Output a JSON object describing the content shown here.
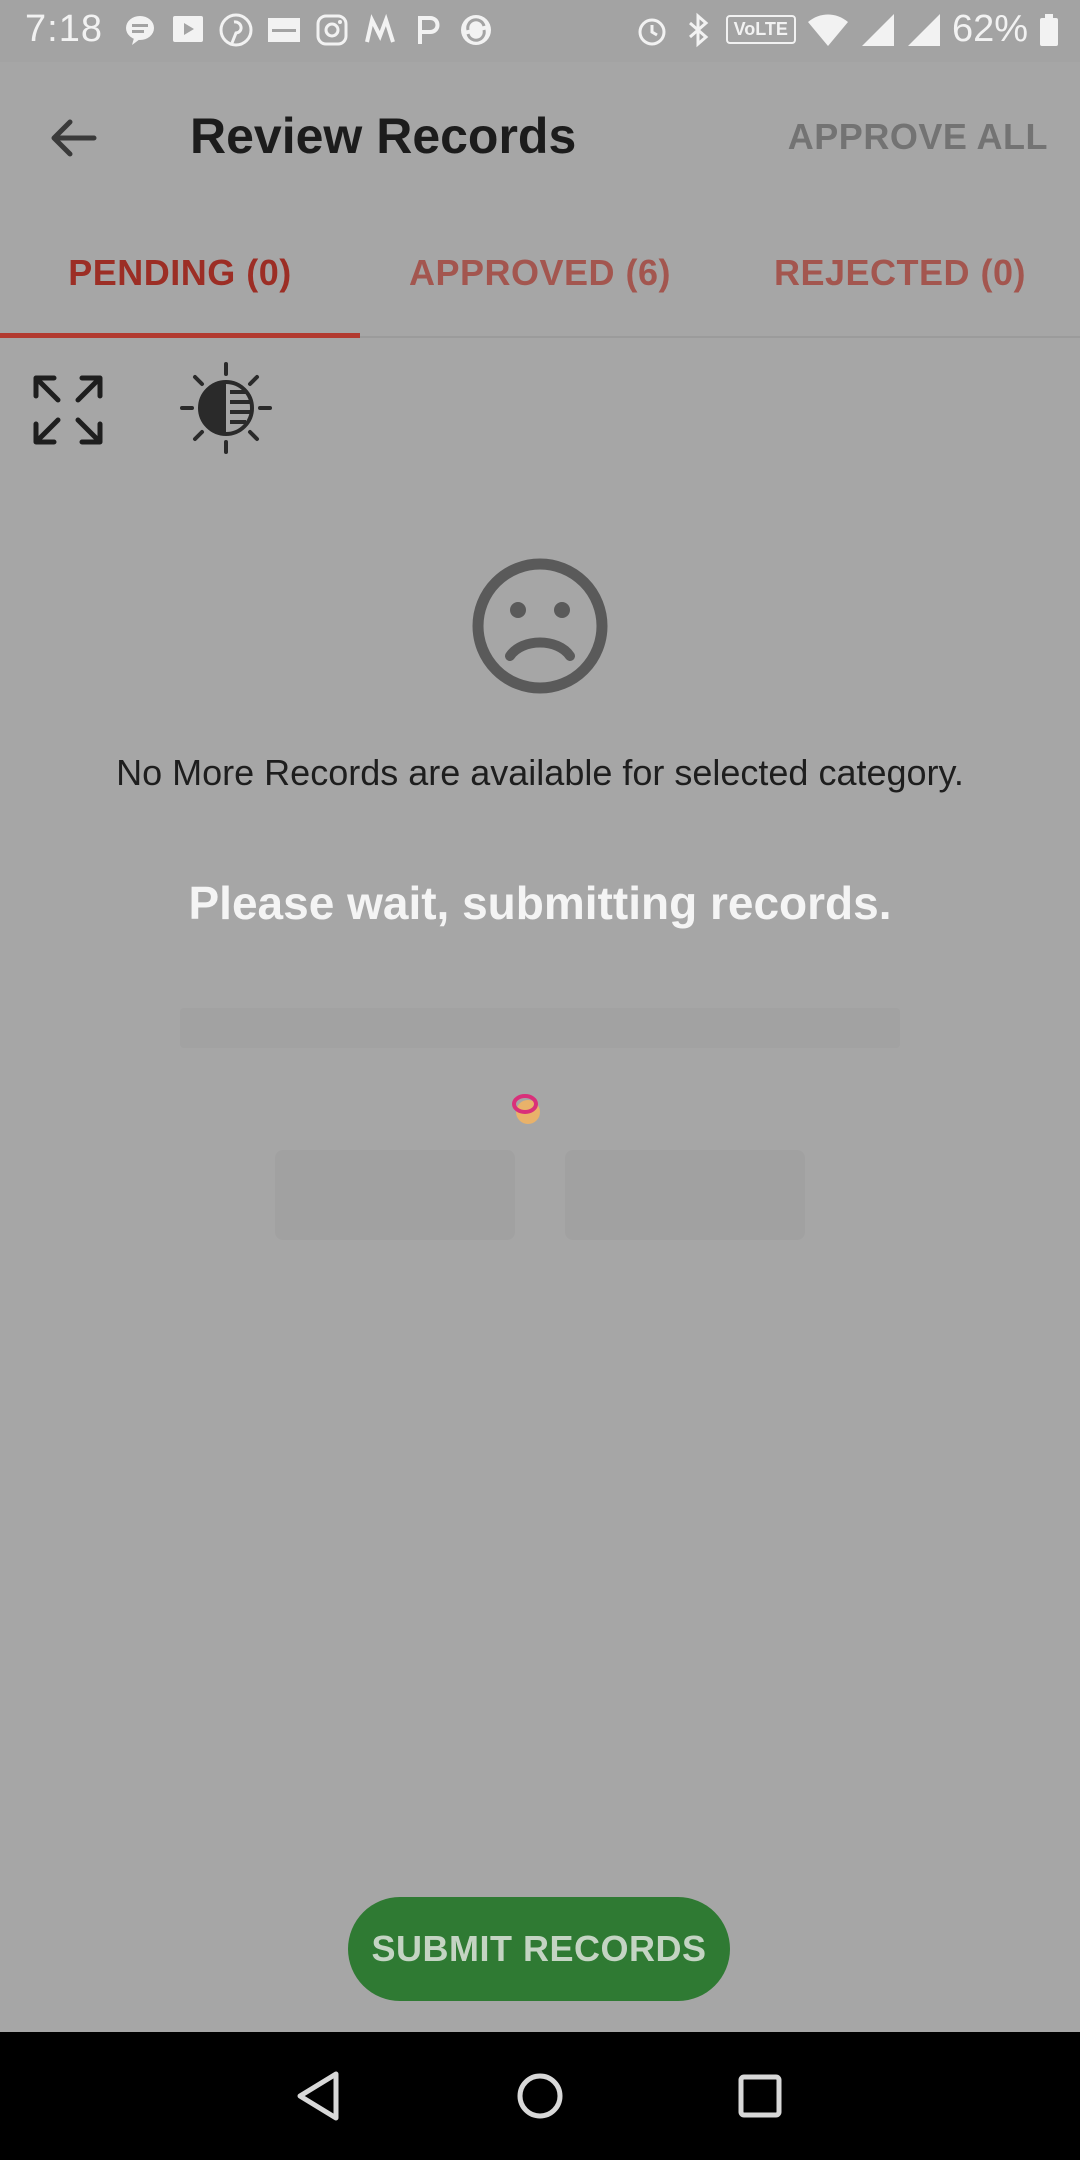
{
  "status_bar": {
    "time": "7:18",
    "battery_percent": "62%",
    "volte_label": "VoLTE",
    "notification_icons": [
      "chat-icon",
      "tv-icon",
      "pinterest-icon",
      "zomato-icon",
      "instagram-icon",
      "m-app-icon",
      "p-app-icon",
      "sync-app-icon"
    ],
    "system_icons": [
      "alarm-icon",
      "bluetooth-icon",
      "volte-icon",
      "wifi-icon",
      "signal-icon",
      "signal-icon",
      "battery-icon"
    ]
  },
  "app_bar": {
    "title": "Review Records",
    "approve_all_label": "APPROVE ALL"
  },
  "tabs": [
    {
      "label": "PENDING (0)",
      "active": true
    },
    {
      "label": "APPROVED (6)",
      "active": false
    },
    {
      "label": "REJECTED (0)",
      "active": false
    }
  ],
  "tools": {
    "expand_icon": "expand-icon",
    "contrast_icon": "brightness-contrast-icon"
  },
  "empty_state": {
    "icon": "sad-face-icon",
    "message": "No More Records are available for selected category."
  },
  "overlay": {
    "message": "Please wait, submitting records."
  },
  "submit_button_label": "SUBMIT RECORDS",
  "colors": {
    "accent_red": "#b23a30",
    "submit_green": "#2f7a33",
    "overlay_gray": "#a6a6a6"
  }
}
